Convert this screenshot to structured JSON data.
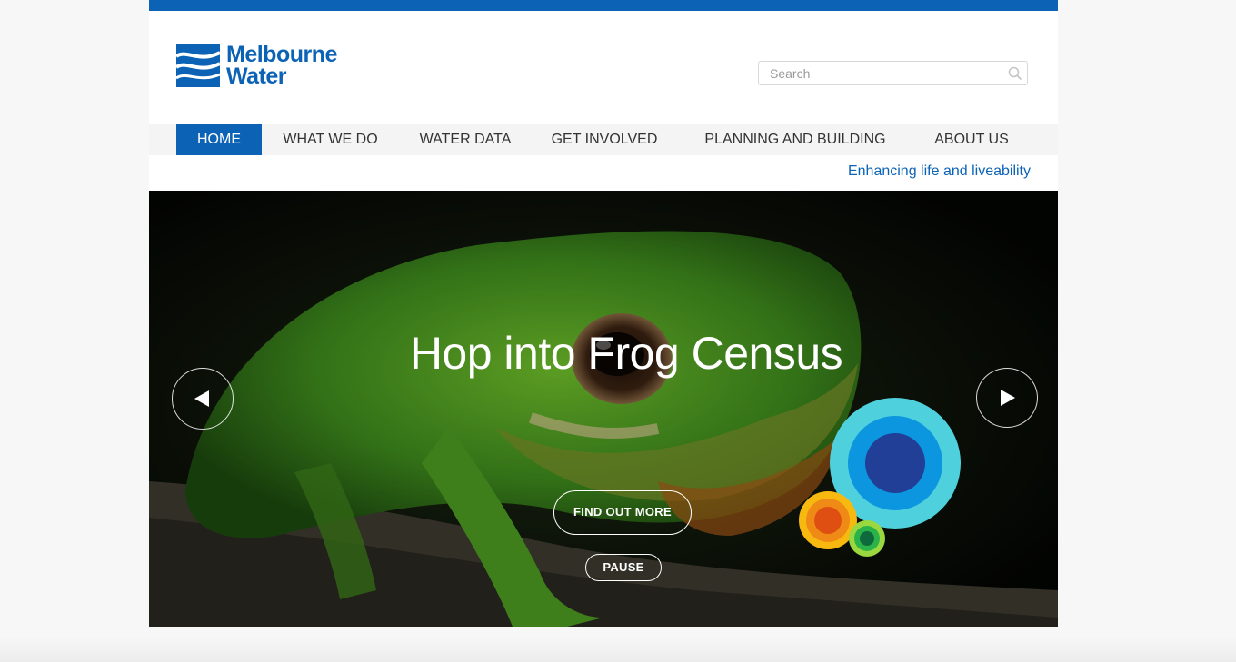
{
  "brand": {
    "name_line1": "Melbourne",
    "name_line2": "Water",
    "logo_icon": "wave-logo-icon",
    "color": "#0c63b6"
  },
  "search": {
    "placeholder": "Search",
    "icon": "search-icon"
  },
  "nav": {
    "items": [
      {
        "label": "HOME",
        "active": true
      },
      {
        "label": "WHAT WE DO",
        "active": false
      },
      {
        "label": "WATER DATA",
        "active": false
      },
      {
        "label": "GET INVOLVED",
        "active": false
      },
      {
        "label": "PLANNING AND BUILDING",
        "active": false
      },
      {
        "label": "ABOUT US",
        "active": false
      }
    ]
  },
  "tagline": "Enhancing life and liveability",
  "hero": {
    "title": "Hop into Frog Census",
    "cta_label": "FIND OUT MORE",
    "pause_label": "PAUSE",
    "prev_icon": "arrow-left-icon",
    "next_icon": "arrow-right-icon",
    "decoration_icon": "concentric-circles-icon"
  },
  "colors": {
    "accent": "#0c63b6",
    "circle_outer": "#4fd0dd",
    "circle_mid": "#0d96e0",
    "circle_inner": "#213f96",
    "orange_outer": "#f7b80f",
    "orange_inner": "#e04f12",
    "green_outer": "#9bd83f",
    "green_inner": "#0e6a3d"
  }
}
